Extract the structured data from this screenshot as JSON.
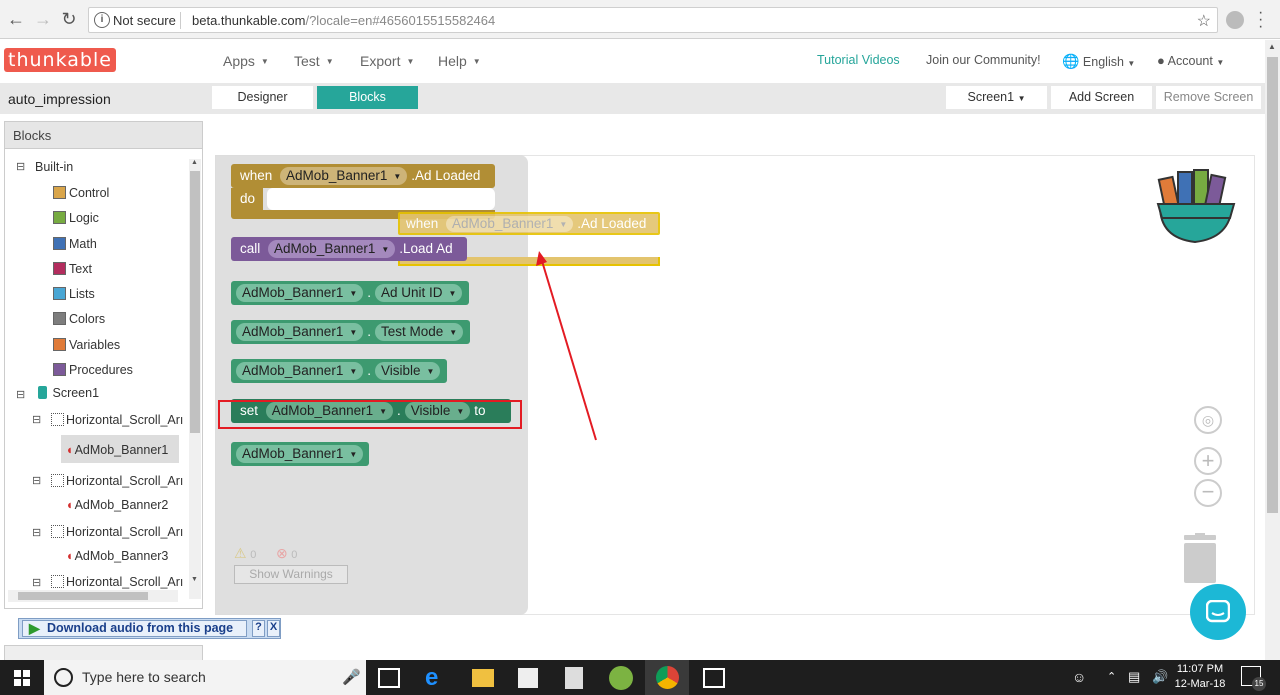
{
  "browser": {
    "security_label": "Not secure",
    "url_host": "beta.thunkable.com",
    "url_rest": "/?locale=en#4656015515582464"
  },
  "header": {
    "logo": "thunkable",
    "menus": [
      "Apps",
      "Test",
      "Export",
      "Help"
    ],
    "tutorial": "Tutorial Videos",
    "community": "Join our Community!",
    "language": "English",
    "account": "Account"
  },
  "toolbar": {
    "project_name": "auto_impression",
    "designer": "Designer",
    "blocks": "Blocks",
    "screen_select": "Screen1",
    "add_screen": "Add Screen",
    "remove_screen": "Remove Screen"
  },
  "blocks_panel": {
    "title": "Blocks",
    "builtin_label": "Built-in",
    "builtins": [
      {
        "label": "Control",
        "color": "#d9a54a"
      },
      {
        "label": "Logic",
        "color": "#77ab41"
      },
      {
        "label": "Math",
        "color": "#3f71b5"
      },
      {
        "label": "Text",
        "color": "#b32d5e"
      },
      {
        "label": "Lists",
        "color": "#49a6d4"
      },
      {
        "label": "Colors",
        "color": "#7d7d7d"
      },
      {
        "label": "Variables",
        "color": "#e07b39"
      },
      {
        "label": "Procedures",
        "color": "#7c5a99"
      }
    ],
    "screen": "Screen1",
    "arrangement": "Horizontal_Scroll_Arı",
    "banners": [
      "AdMob_Banner1",
      "AdMob_Banner2",
      "AdMob_Banner3"
    ]
  },
  "flyout": {
    "when_kw": "when",
    "do_kw": "do",
    "component": "AdMob_Banner1",
    "event": ".Ad Loaded",
    "call_kw": "call",
    "method": ".Load Ad",
    "prop_ad_unit": "Ad Unit ID",
    "prop_test_mode": "Test Mode",
    "prop_visible": "Visible",
    "set_kw": "set",
    "to_kw": "to",
    "dot": "."
  },
  "warnings": {
    "warn_count": "0",
    "error_count": "0",
    "show_label": "Show Warnings"
  },
  "download_bar": {
    "label": "Download audio from this page",
    "help": "?",
    "close": "X"
  },
  "taskbar": {
    "search_placeholder": "Type here to search",
    "time": "11:07 PM",
    "date": "12-Mar-18",
    "notif_count": "15"
  }
}
